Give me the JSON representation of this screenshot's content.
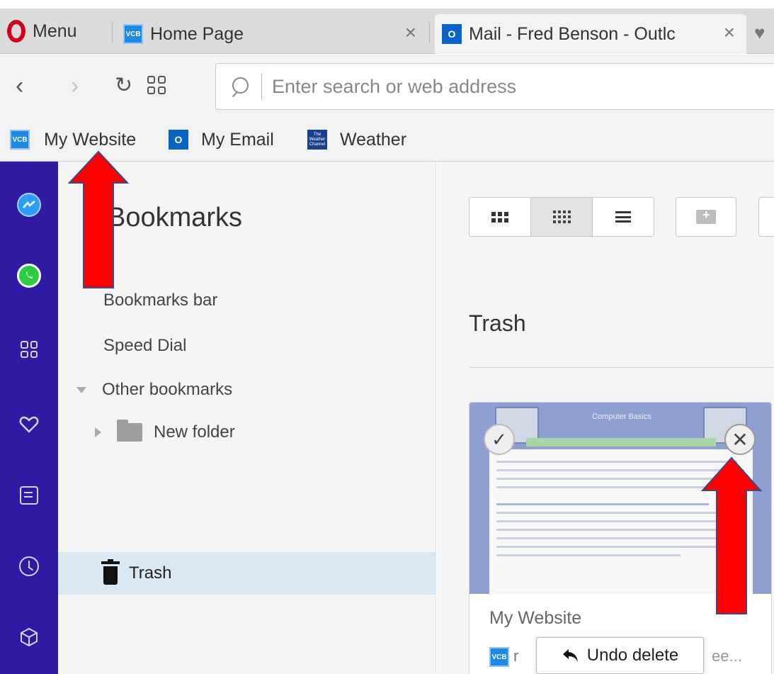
{
  "tabs": {
    "menu_label": "Menu",
    "tab1_title": "Home Page",
    "tab2_title": "Mail - Fred Benson - Outlc",
    "close_glyph": "×"
  },
  "address": {
    "placeholder": "Enter search or web address"
  },
  "bookmarks_bar": {
    "items": [
      {
        "label": "My Website",
        "icon": "vcb-favicon"
      },
      {
        "label": "My Email",
        "icon": "outlook-favicon"
      },
      {
        "label": "Weather",
        "icon": "weather-channel-favicon"
      }
    ]
  },
  "favicons": {
    "vcb": "VCB",
    "outlook": "O",
    "weather": "The Weather Channel"
  },
  "sidebar": {
    "icons": [
      "messenger-icon",
      "whatsapp-icon",
      "speed-dial-icon",
      "heart-icon",
      "news-icon",
      "history-icon",
      "cube-icon"
    ]
  },
  "tree": {
    "title": "Bookmarks",
    "items": [
      {
        "label": "Bookmarks bar"
      },
      {
        "label": "Speed Dial"
      },
      {
        "label": "Other bookmarks"
      },
      {
        "label": "New folder"
      }
    ],
    "selected": "Trash"
  },
  "main": {
    "section_title": "Trash",
    "card": {
      "title": "My Website",
      "url_left": "r",
      "url_right": "ee...",
      "thumb_title": "Computer Basics"
    },
    "undo_label": "Undo delete"
  },
  "colors": {
    "sidebar": "#2e1aa3",
    "selected_row": "#d9e8f2",
    "arrow": "#ff0000",
    "opera_red": "#d0021b"
  }
}
